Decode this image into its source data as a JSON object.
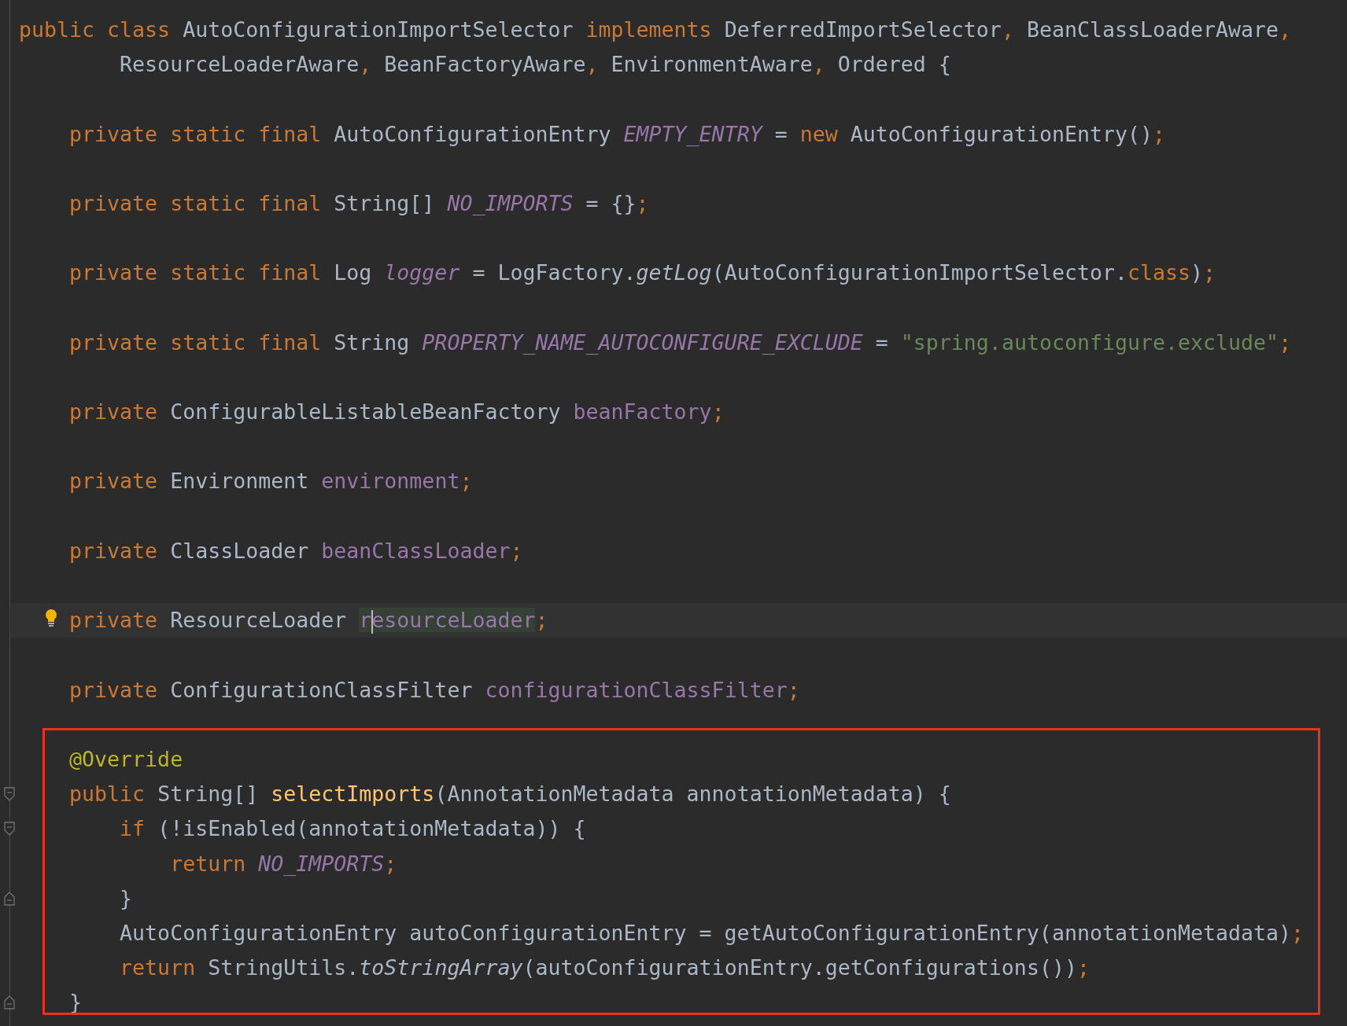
{
  "editor": {
    "lines": [
      {
        "kind": "code",
        "tokens": [
          {
            "text": "public class ",
            "kind": "keyword"
          },
          {
            "text": "AutoConfigurationImportSelector ",
            "kind": "plain"
          },
          {
            "text": "implements ",
            "kind": "keyword"
          },
          {
            "text": "DeferredImportSelector",
            "kind": "plain"
          },
          {
            "text": ", ",
            "kind": "punct"
          },
          {
            "text": "BeanClassLoaderAware",
            "kind": "plain"
          },
          {
            "text": ",",
            "kind": "punct"
          }
        ]
      },
      {
        "kind": "code",
        "tokens": [
          {
            "text": "        ResourceLoaderAware",
            "kind": "plain"
          },
          {
            "text": ", ",
            "kind": "punct"
          },
          {
            "text": "BeanFactoryAware",
            "kind": "plain"
          },
          {
            "text": ", ",
            "kind": "punct"
          },
          {
            "text": "EnvironmentAware",
            "kind": "plain"
          },
          {
            "text": ", ",
            "kind": "punct"
          },
          {
            "text": "Ordered {",
            "kind": "plain"
          }
        ]
      },
      {
        "kind": "blank"
      },
      {
        "kind": "code",
        "tokens": [
          {
            "text": "    private static final ",
            "kind": "keyword"
          },
          {
            "text": "AutoConfigurationEntry ",
            "kind": "plain"
          },
          {
            "text": "EMPTY_ENTRY",
            "kind": "static_field"
          },
          {
            "text": " = ",
            "kind": "plain"
          },
          {
            "text": "new ",
            "kind": "keyword"
          },
          {
            "text": "AutoConfigurationEntry()",
            "kind": "plain"
          },
          {
            "text": ";",
            "kind": "punct"
          }
        ]
      },
      {
        "kind": "blank"
      },
      {
        "kind": "code",
        "tokens": [
          {
            "text": "    private static final ",
            "kind": "keyword"
          },
          {
            "text": "String[] ",
            "kind": "plain"
          },
          {
            "text": "NO_IMPORTS",
            "kind": "static_field"
          },
          {
            "text": " = {}",
            "kind": "plain"
          },
          {
            "text": ";",
            "kind": "punct"
          }
        ]
      },
      {
        "kind": "blank"
      },
      {
        "kind": "code",
        "tokens": [
          {
            "text": "    private static final ",
            "kind": "keyword"
          },
          {
            "text": "Log ",
            "kind": "plain"
          },
          {
            "text": "logger",
            "kind": "static_field"
          },
          {
            "text": " = LogFactory.",
            "kind": "plain"
          },
          {
            "text": "getLog",
            "kind": "static_call"
          },
          {
            "text": "(AutoConfigurationImportSelector.",
            "kind": "plain"
          },
          {
            "text": "class",
            "kind": "keyword"
          },
          {
            "text": ")",
            "kind": "plain"
          },
          {
            "text": ";",
            "kind": "punct"
          }
        ]
      },
      {
        "kind": "blank"
      },
      {
        "kind": "code",
        "tokens": [
          {
            "text": "    private static final ",
            "kind": "keyword"
          },
          {
            "text": "String ",
            "kind": "plain"
          },
          {
            "text": "PROPERTY_NAME_AUTOCONFIGURE_EXCLUDE",
            "kind": "static_field"
          },
          {
            "text": " = ",
            "kind": "plain"
          },
          {
            "text": "\"spring.autoconfigure.exclude\"",
            "kind": "string"
          },
          {
            "text": ";",
            "kind": "punct"
          }
        ]
      },
      {
        "kind": "blank"
      },
      {
        "kind": "code",
        "tokens": [
          {
            "text": "    private ",
            "kind": "keyword"
          },
          {
            "text": "ConfigurableListableBeanFactory ",
            "kind": "plain"
          },
          {
            "text": "beanFactory",
            "kind": "field"
          },
          {
            "text": ";",
            "kind": "punct"
          }
        ]
      },
      {
        "kind": "blank"
      },
      {
        "kind": "code",
        "tokens": [
          {
            "text": "    private ",
            "kind": "keyword"
          },
          {
            "text": "Environment ",
            "kind": "plain"
          },
          {
            "text": "environment",
            "kind": "field"
          },
          {
            "text": ";",
            "kind": "punct"
          }
        ]
      },
      {
        "kind": "blank"
      },
      {
        "kind": "code",
        "tokens": [
          {
            "text": "    private ",
            "kind": "keyword"
          },
          {
            "text": "ClassLoader ",
            "kind": "plain"
          },
          {
            "text": "beanClassLoader",
            "kind": "field"
          },
          {
            "text": ";",
            "kind": "punct"
          }
        ]
      },
      {
        "kind": "blank"
      },
      {
        "kind": "current",
        "tokens": [
          {
            "text": "    private ",
            "kind": "keyword"
          },
          {
            "text": "ResourceLoader ",
            "kind": "plain"
          },
          {
            "text": "r",
            "kind": "field_highlighted"
          },
          {
            "kind": "caret"
          },
          {
            "text": "esourceLoader",
            "kind": "field_highlighted"
          },
          {
            "text": ";",
            "kind": "punct"
          }
        ]
      },
      {
        "kind": "blank"
      },
      {
        "kind": "code",
        "tokens": [
          {
            "text": "    private ",
            "kind": "keyword"
          },
          {
            "text": "ConfigurationClassFilter ",
            "kind": "plain"
          },
          {
            "text": "configurationClassFilter",
            "kind": "field"
          },
          {
            "text": ";",
            "kind": "punct"
          }
        ]
      },
      {
        "kind": "blank"
      }
    ],
    "framed_block": {
      "lines": [
        {
          "kind": "code",
          "tokens": [
            {
              "text": "    @Override",
              "kind": "annotation"
            }
          ]
        },
        {
          "kind": "fold_start",
          "tokens": [
            {
              "text": "    public ",
              "kind": "keyword"
            },
            {
              "text": "String[] ",
              "kind": "plain"
            },
            {
              "text": "selectImports",
              "kind": "method_decl"
            },
            {
              "text": "(AnnotationMetadata annotationMetadata) {",
              "kind": "plain"
            }
          ]
        },
        {
          "kind": "fold_start",
          "tokens": [
            {
              "text": "        if ",
              "kind": "keyword"
            },
            {
              "text": "(!isEnabled(annotationMetadata)) {",
              "kind": "plain"
            }
          ]
        },
        {
          "kind": "code",
          "tokens": [
            {
              "text": "            return ",
              "kind": "keyword"
            },
            {
              "text": "NO_IMPORTS",
              "kind": "static_field"
            },
            {
              "text": ";",
              "kind": "punct"
            }
          ]
        },
        {
          "kind": "fold_end",
          "tokens": [
            {
              "text": "        }",
              "kind": "plain"
            }
          ]
        },
        {
          "kind": "code",
          "tokens": [
            {
              "text": "        AutoConfigurationEntry autoConfigurationEntry = getAutoConfigurationEntry(annotationMetadata)",
              "kind": "plain"
            },
            {
              "text": ";",
              "kind": "punct"
            }
          ]
        },
        {
          "kind": "code",
          "tokens": [
            {
              "text": "        return ",
              "kind": "keyword"
            },
            {
              "text": "StringUtils.",
              "kind": "plain"
            },
            {
              "text": "toStringArray",
              "kind": "static_call"
            },
            {
              "text": "(autoConfigurationEntry.getConfigurations())",
              "kind": "plain"
            },
            {
              "text": ";",
              "kind": "punct"
            }
          ]
        },
        {
          "kind": "fold_end",
          "tokens": [
            {
              "text": "    }",
              "kind": "plain"
            }
          ]
        }
      ]
    }
  }
}
